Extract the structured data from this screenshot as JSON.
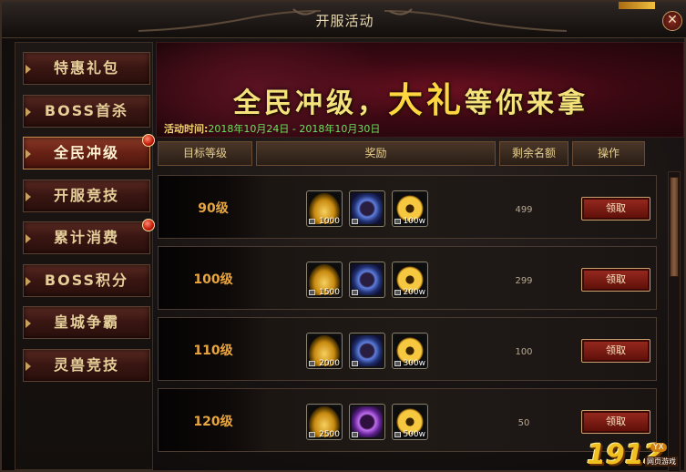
{
  "window": {
    "title": "开服活动",
    "close_label": "✕"
  },
  "sidebar": {
    "items": [
      {
        "label": "特惠礼包",
        "active": false,
        "badge": false
      },
      {
        "label": "BOSS首杀",
        "active": false,
        "badge": false
      },
      {
        "label": "全民冲级",
        "active": true,
        "badge": true
      },
      {
        "label": "开服竞技",
        "active": false,
        "badge": false
      },
      {
        "label": "累计消费",
        "active": false,
        "badge": true
      },
      {
        "label": "BOSS积分",
        "active": false,
        "badge": false
      },
      {
        "label": "皇城争霸",
        "active": false,
        "badge": false
      },
      {
        "label": "灵兽竞技",
        "active": false,
        "badge": false
      }
    ]
  },
  "banner": {
    "slogan_a": "全民冲级，",
    "slogan_b": "大礼",
    "slogan_c": "等你来拿",
    "period_label": "活动时间:",
    "period_value": "2018年10月24日 - 2018年10月30日"
  },
  "table": {
    "headers": {
      "level": "目标等级",
      "reward": "奖励",
      "remain": "剩余名额",
      "action": "操作"
    },
    "rows": [
      {
        "level": "90级",
        "rewards": [
          {
            "icon": "gold-ingot-icon",
            "qty": "1000"
          },
          {
            "icon": "blue-emblem-icon",
            "qty": ""
          },
          {
            "icon": "gold-coin-icon",
            "qty": "100w"
          }
        ],
        "remain": "499",
        "claim": "领取"
      },
      {
        "level": "100级",
        "rewards": [
          {
            "icon": "gold-ingot-icon",
            "qty": "1500"
          },
          {
            "icon": "blue-emblem-icon",
            "qty": ""
          },
          {
            "icon": "gold-coin-icon",
            "qty": "200w"
          }
        ],
        "remain": "299",
        "claim": "领取"
      },
      {
        "level": "110级",
        "rewards": [
          {
            "icon": "gold-ingot-icon",
            "qty": "2000"
          },
          {
            "icon": "blue-emblem-icon",
            "qty": ""
          },
          {
            "icon": "gold-coin-icon",
            "qty": "300w"
          }
        ],
        "remain": "100",
        "claim": "领取"
      },
      {
        "level": "120级",
        "rewards": [
          {
            "icon": "gold-ingot-icon",
            "qty": "2500"
          },
          {
            "icon": "purple-emblem-icon",
            "qty": ""
          },
          {
            "icon": "gold-coin-icon",
            "qty": "500w"
          }
        ],
        "remain": "50",
        "claim": "领取"
      }
    ]
  },
  "logo": {
    "number": "1912",
    "tag": "YX",
    "sub": "网页游戏"
  },
  "colors": {
    "accent_gold": "#f6e27a",
    "period_green": "#6fe060",
    "level_orange": "#e8a640",
    "button_red": "#9a2a20"
  }
}
